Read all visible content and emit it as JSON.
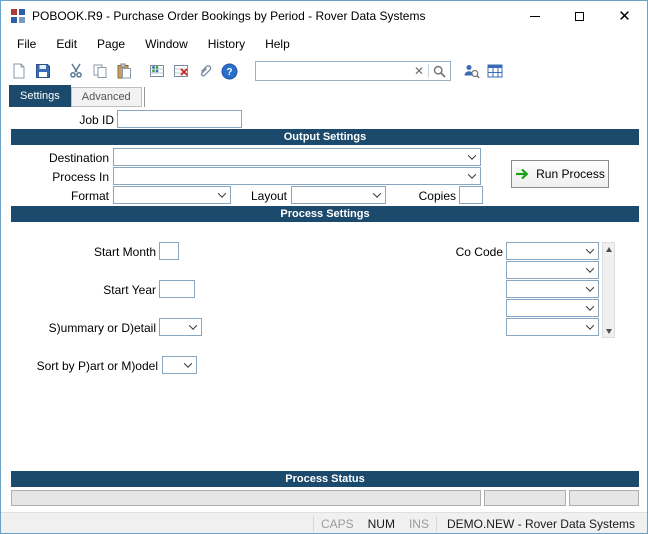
{
  "titlebar": {
    "title": "POBOOK.R9 - Purchase Order Bookings by Period - Rover Data Systems"
  },
  "menubar": {
    "items": [
      "File",
      "Edit",
      "Page",
      "Window",
      "History",
      "Help"
    ]
  },
  "toolbar": {
    "search_value": ""
  },
  "tabs": {
    "settings": "Settings",
    "advanced": "Advanced"
  },
  "form": {
    "job_id_label": "Job ID",
    "output_settings_header": "Output Settings",
    "destination_label": "Destination",
    "process_in_label": "Process In",
    "format_label": "Format",
    "layout_label": "Layout",
    "copies_label": "Copies",
    "run_process": "Run Process",
    "process_settings_header": "Process Settings",
    "start_month_label": "Start Month",
    "start_year_label": "Start Year",
    "summary_detail_label": "S)ummary or D)etail",
    "sort_by_label": "Sort by P)art or M)odel",
    "co_code_label": "Co Code",
    "process_status_header": "Process Status"
  },
  "statusbar": {
    "caps": "CAPS",
    "num": "NUM",
    "ins": "INS",
    "workspace": "DEMO.NEW - Rover Data Systems"
  },
  "colors": {
    "section_header_bar": "#1b4a6c",
    "run_arrow_green": "#18a018",
    "help_blue": "#2a6fc9",
    "window_border": "#6aa1c8"
  }
}
